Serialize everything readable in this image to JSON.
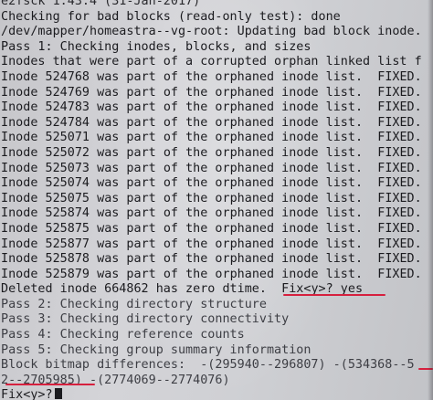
{
  "terminal": {
    "version_line": "e2fsck 1.43.4 (31-Jan-2017)",
    "bad_blocks_line": "Checking for bad blocks (read-only test): done",
    "update_line": "/dev/mapper/homeastra--vg-root: Updating bad block inode.",
    "pass1_line": "Pass 1: Checking inodes, blocks, and sizes",
    "orphan_header": "Inodes that were part of a corrupted orphan linked list f",
    "orphan_text": "was part of the orphaned inode list.",
    "fixed_label": "FIXED.",
    "inode_label": "Inode",
    "orphan_inodes": [
      "524768",
      "524769",
      "524783",
      "524784",
      "525071",
      "525072",
      "525073",
      "525074",
      "525075",
      "525874",
      "525875",
      "525877",
      "525878",
      "525879"
    ],
    "deleted_line": "Deleted inode 664862 has zero dtime.",
    "fix_prompt": "Fix<y>? yes",
    "pass2_line": "Pass 2: Checking directory structure",
    "pass3_line": "Pass 3: Checking directory connectivity",
    "pass4_line": "Pass 4: Checking reference counts",
    "pass5_line": "Pass 5: Checking group summary information",
    "bitmap_line": "Block bitmap differences:  -(295940--296807) -(534368--5",
    "bitmap_cont_line": "2--2705985) -(2774069--2774076)",
    "final_prompt": "Fix<y>?"
  },
  "colors": {
    "text": "#1b1b1f",
    "background": "#cfd0d4",
    "annotation_red": "#d6203e"
  }
}
